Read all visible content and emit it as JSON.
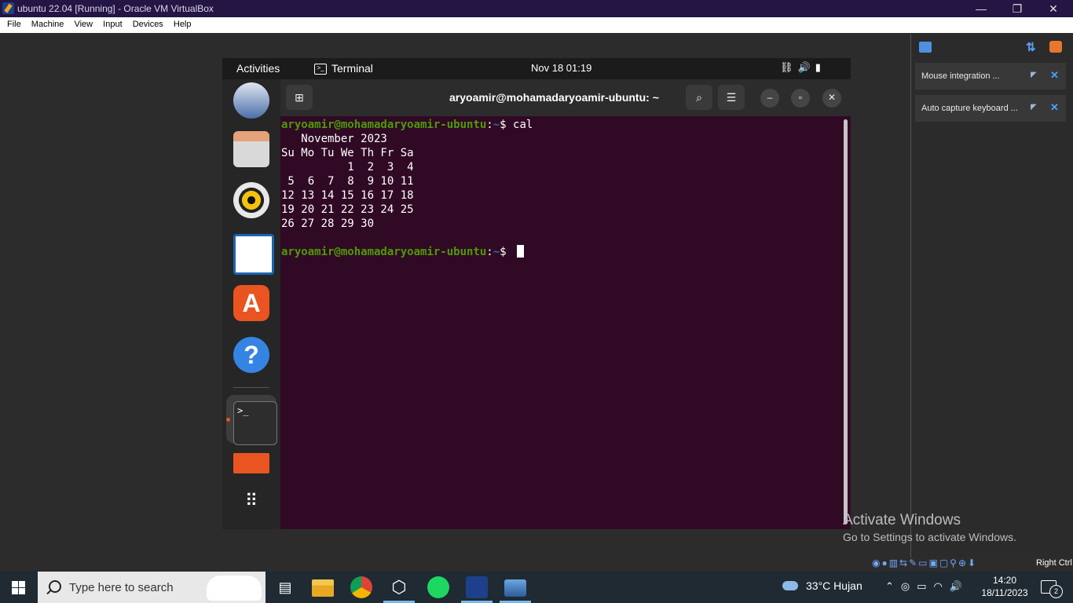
{
  "vbox": {
    "window_title": "ubuntu 22.04 [Running] - Oracle VM VirtualBox",
    "controls": {
      "minimize": "—",
      "restore": "❐",
      "close": "✕"
    },
    "menu": [
      "File",
      "Machine",
      "View",
      "Input",
      "Devices",
      "Help"
    ],
    "notifications": [
      {
        "text": "Mouse integration ..."
      },
      {
        "text": "Auto capture keyboard ..."
      }
    ],
    "host_key": "Right Ctrl"
  },
  "ubuntu": {
    "activities": "Activities",
    "app_name": "Terminal",
    "clock": "Nov 18  01:19",
    "terminal": {
      "title": "aryoamir@mohamadaryoamir-ubuntu: ~",
      "prompt_user": "aryoamir@mohamadaryoamir-ubuntu",
      "prompt_sep": ":",
      "prompt_path": "~",
      "prompt_end": "$ ",
      "command": "cal",
      "output": "   November 2023\nSu Mo Tu We Th Fr Sa\n          1  2  3  4\n 5  6  7  8  9 10 11\n12 13 14 15 16 17 18\n19 20 21 22 23 24 25\n26 27 28 29 30\n"
    }
  },
  "watermark": {
    "line1": "Activate Windows",
    "line2": "Go to Settings to activate Windows."
  },
  "taskbar": {
    "search_placeholder": "Type here to search",
    "weather": "33°C  Hujan",
    "time": "14:20",
    "date": "18/11/2023",
    "notification_count": "2"
  }
}
